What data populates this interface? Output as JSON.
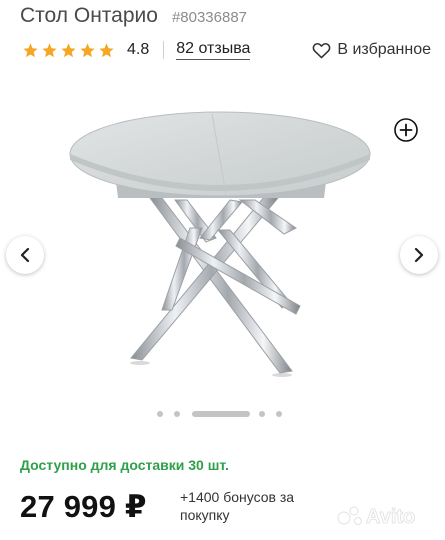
{
  "product": {
    "title": "Стол Онтарио",
    "sku": "#80336887",
    "rating": "4.8",
    "star_count": 5,
    "reviews": "82 отзыва",
    "favorite_label": "В избранное"
  },
  "gallery": {
    "image_alt": "round grey table with chrome crossed legs",
    "dot_count": 5,
    "active_dot": 2
  },
  "offer": {
    "availability": "Доступно для доставки 30 шт.",
    "price": "27 999 ₽",
    "bonus": "+1400 бонусов за покупку"
  },
  "watermark": {
    "text": "Avito"
  },
  "colors": {
    "star": "#f5a623",
    "availability": "#2fa04a",
    "text_primary": "#111111",
    "text_secondary": "#8c8c8c"
  }
}
